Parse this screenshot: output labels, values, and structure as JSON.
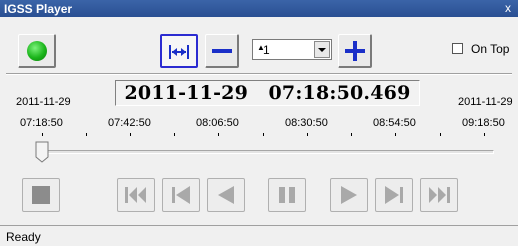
{
  "window": {
    "title": "IGSS Player",
    "close_glyph": "x"
  },
  "toolbar": {
    "run_icon": "green-status-icon",
    "fit_icon": "fit-range-icon",
    "zoom_out_icon": "minus-icon",
    "zoom_in_icon": "plus-icon",
    "speed_value": "1",
    "speed_indicator": "▲",
    "on_top_label": "On Top",
    "on_top_checked": false
  },
  "display": {
    "date": "2011-11-29",
    "time": "07:18:50.469"
  },
  "range": {
    "start_date": "2011-11-29",
    "end_date": "2011-11-29",
    "ticks": [
      "07:18:50",
      "07:42:50",
      "08:06:50",
      "08:30:50",
      "08:54:50",
      "09:18:50"
    ]
  },
  "slider": {
    "position_fraction": 0.0
  },
  "transport": {
    "stop": "stop-icon",
    "first": "skip-first-icon",
    "prev_step": "step-back-icon",
    "reverse": "play-reverse-icon",
    "pause": "pause-icon",
    "play": "play-icon",
    "next_step": "step-forward-icon",
    "last": "skip-last-icon"
  },
  "colors": {
    "title_bar": "#2a4f92",
    "accent_blue": "#1a2fc8",
    "run_green": "#1bb51b",
    "disabled_gray": "#a9a9a9"
  },
  "status": {
    "text": "Ready"
  }
}
